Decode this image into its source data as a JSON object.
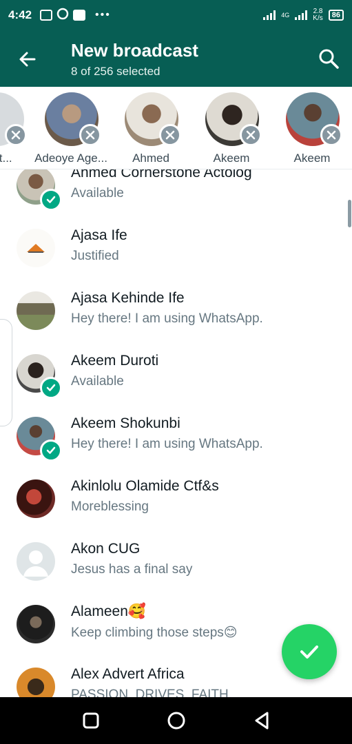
{
  "status_bar": {
    "time": "4:42",
    "dots": "•••",
    "network_top": "2.8",
    "network_bottom": "K/s",
    "signal_label": "4G",
    "battery": "86"
  },
  "app_bar": {
    "title": "New broadcast",
    "subtitle": "8 of 256 selected",
    "back_icon": "arrow-left-icon",
    "search_icon": "search-icon",
    "color": "#075e54"
  },
  "selected": [
    {
      "name": "Part...",
      "avatar_color": "#d7dbde"
    },
    {
      "name": "Adeoye Age...",
      "avatar_color": "#6b5a4a"
    },
    {
      "name": "Ahmed",
      "avatar_color": "#9c8a76"
    },
    {
      "name": "Akeem",
      "avatar_color": "#3c3a36"
    },
    {
      "name": "Akeem",
      "avatar_color": "#b9423b"
    }
  ],
  "contacts": [
    {
      "name": "Ahmed Cornerstone Actolog",
      "status": "Available",
      "checked": true,
      "avatar_color": "#8fa08a"
    },
    {
      "name": "Ajasa Ife",
      "status": "Justified",
      "checked": false,
      "avatar_color": "#f4efe6"
    },
    {
      "name": "Ajasa Kehinde Ife",
      "status": "Hey there! I am using WhatsApp.",
      "checked": false,
      "avatar_color": "#7c8a5a"
    },
    {
      "name": "Akeem Duroti",
      "status": "Available",
      "checked": true,
      "avatar_color": "#4a4a4a"
    },
    {
      "name": "Akeem Shokunbi",
      "status": "Hey there! I am using WhatsApp.",
      "checked": true,
      "avatar_color": "#c44a44"
    },
    {
      "name": "Akinlolu Olamide Ctf&s",
      "status": "Moreblessing",
      "checked": false,
      "avatar_color": "#6e2a26"
    },
    {
      "name": "Akon CUG",
      "status": "Jesus has a final say",
      "checked": false,
      "avatar_color": "#dfe5e7"
    },
    {
      "name": "Alameen🥰",
      "status": "Keep climbing those steps😊",
      "checked": false,
      "avatar_color": "#2b2b2b"
    },
    {
      "name": "Alex Advert Africa",
      "status": "PASSION. DRIVES. FAITH.",
      "checked": false,
      "avatar_color": "#d9892b"
    }
  ],
  "fab": {
    "icon": "checkmark-icon",
    "color": "#25d366"
  },
  "accent": "#00a884",
  "nav": {
    "recents_icon": "square-icon",
    "home_icon": "circle-icon",
    "back_icon": "triangle-back-icon"
  }
}
